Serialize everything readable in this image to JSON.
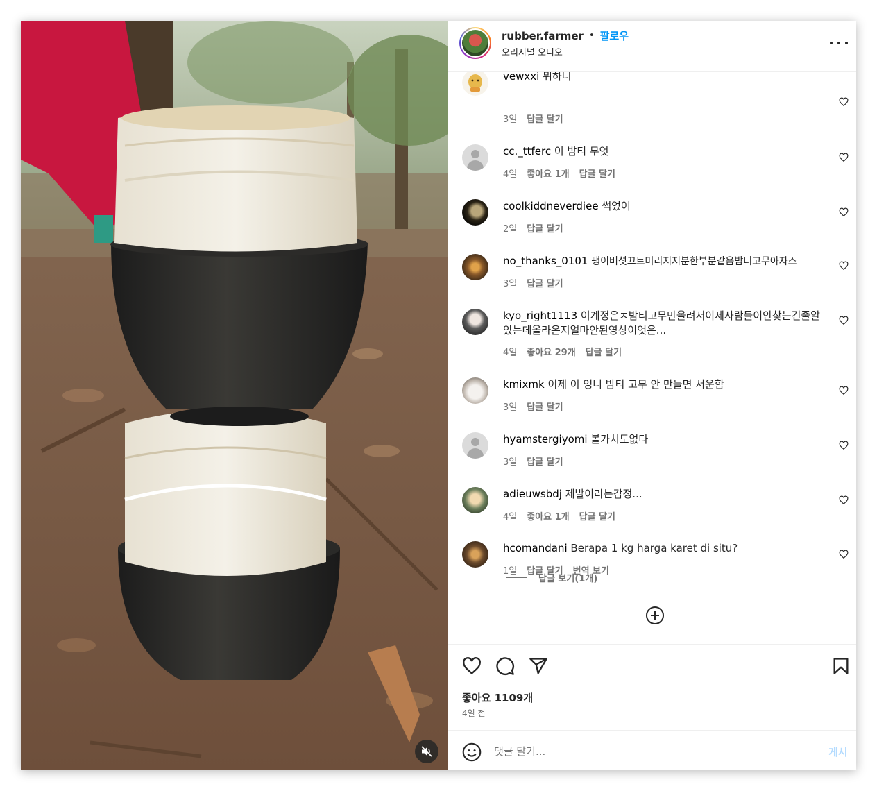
{
  "header": {
    "username": "rubber.farmer",
    "separator": "•",
    "follow_label": "팔로우",
    "audio": "오리지널 오디오"
  },
  "comments": [
    {
      "username": "vewxxi",
      "text": "뭐하니",
      "time": "3일",
      "likes": "",
      "reply": "답글 달기",
      "translate": ""
    },
    {
      "username": "cc._ttferc",
      "text": "이 밤티 무엇",
      "time": "4일",
      "likes": "좋아요 1개",
      "reply": "답글 달기",
      "translate": ""
    },
    {
      "username": "coolkiddneverdiee",
      "text": "썩었어",
      "time": "2일",
      "likes": "",
      "reply": "답글 달기",
      "translate": ""
    },
    {
      "username": "no_thanks_0101",
      "text": "팽이버섯끄트머리지저분한부분같음밤티고무아자스",
      "time": "3일",
      "likes": "",
      "reply": "답글 달기",
      "translate": ""
    },
    {
      "username": "kyo_right1113",
      "text": "이계정은ㅈ밤티고무만올려서이제사람들이안찾는건줄알았는데올라온지얼마안된영상이엇은...",
      "time": "4일",
      "likes": "좋아요 29개",
      "reply": "답글 달기",
      "translate": ""
    },
    {
      "username": "kmixmk",
      "text": "이제 이 엉니 밤티 고무 안 만들면 서운함",
      "time": "3일",
      "likes": "",
      "reply": "답글 달기",
      "translate": ""
    },
    {
      "username": "hyamstergiyomi",
      "text": "볼가치도없다",
      "time": "3일",
      "likes": "",
      "reply": "답글 달기",
      "translate": ""
    },
    {
      "username": "adieuwsbdj",
      "text": "제발이라는감정...",
      "time": "4일",
      "likes": "좋아요 1개",
      "reply": "답글 달기",
      "translate": ""
    },
    {
      "username": "hcomandani",
      "text": "Berapa 1 kg harga karet di situ?",
      "time": "1일",
      "likes": "",
      "reply": "답글 달기",
      "translate": "번역 보기"
    }
  ],
  "view_replies": "답글 보기(1개)",
  "post": {
    "likes": "좋아요 1109개",
    "time": "4일 전"
  },
  "composer": {
    "placeholder": "댓글 달기...",
    "post_label": "게시"
  },
  "colors": {
    "accent": "#0095f6",
    "muted_text": "#737373",
    "post_disabled": "#b3dbff"
  },
  "icons": [
    "more-icon",
    "heart-icon",
    "comment-icon",
    "share-icon",
    "bookmark-icon",
    "plus-circle-icon",
    "emoji-icon",
    "muted-speaker-icon"
  ]
}
